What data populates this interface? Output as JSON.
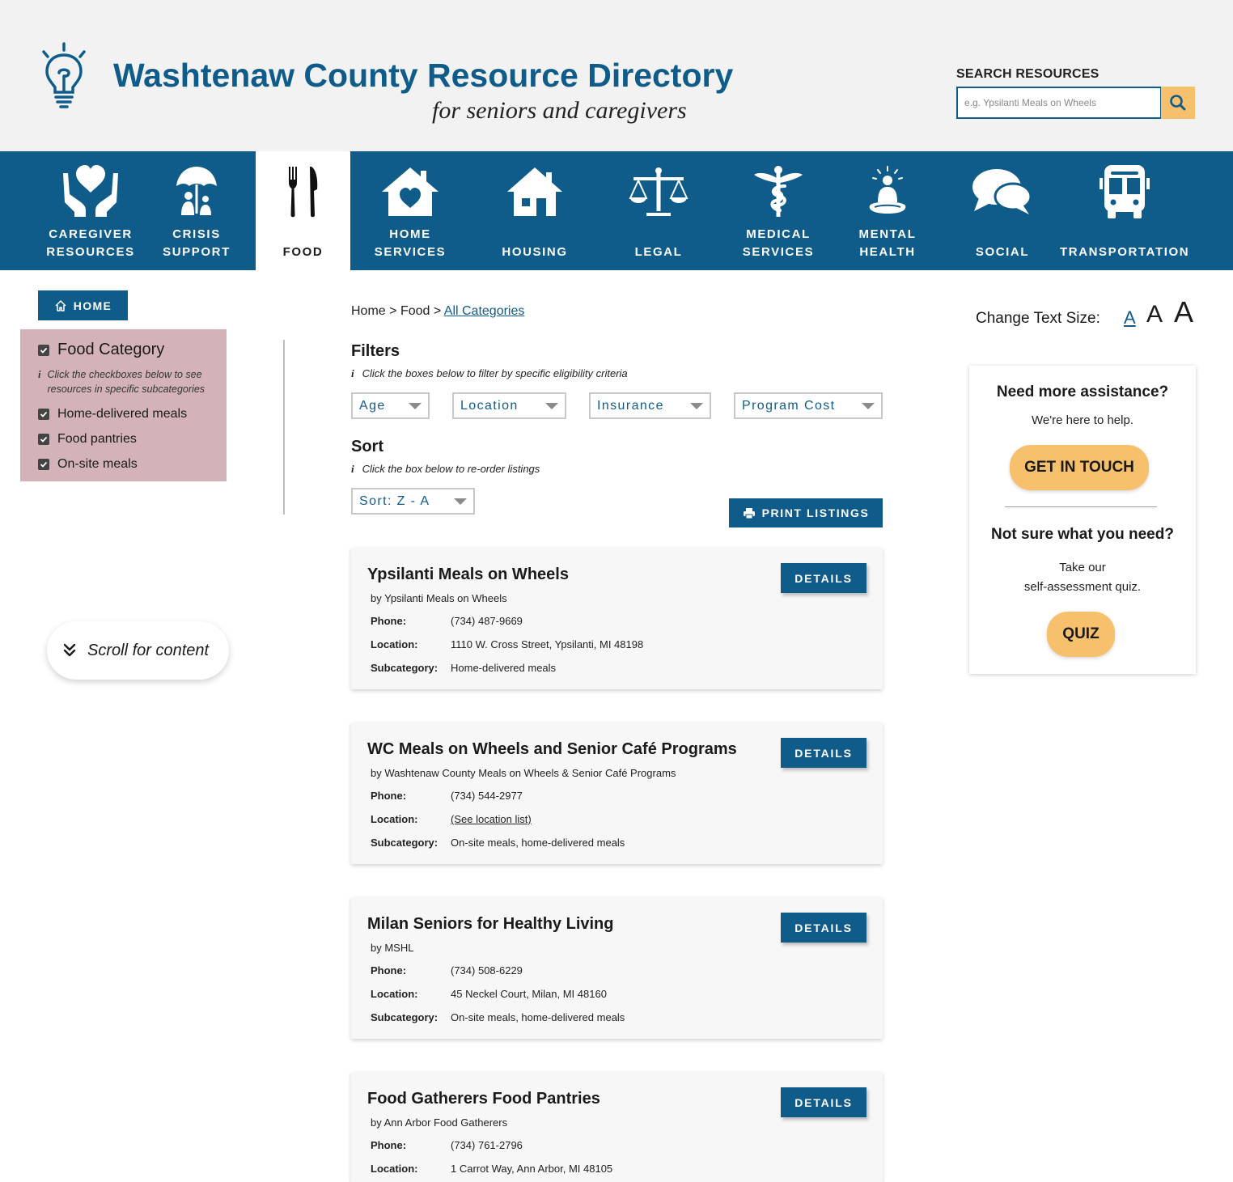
{
  "header": {
    "title": "Washtenaw County Resource Directory",
    "subtitle": "for seniors and caregivers",
    "search_label": "SEARCH RESOURCES",
    "search_placeholder": "e.g. Ypsilanti Meals on Wheels",
    "search_value": "",
    "logo_icon": "lightbulb-icon",
    "search_icon": "magnifier-icon"
  },
  "nav": [
    {
      "label": "CAREGIVER\nRESOURCES",
      "icon": "hands-heart-icon",
      "active": false
    },
    {
      "label": "CRISIS\nSUPPORT",
      "icon": "umbrella-people-icon",
      "active": false
    },
    {
      "label": "FOOD",
      "icon": "fork-knife-icon",
      "active": true
    },
    {
      "label": "HOME\nSERVICES",
      "icon": "house-heart-icon",
      "active": false
    },
    {
      "label": "HOUSING",
      "icon": "house-icon",
      "active": false
    },
    {
      "label": "LEGAL",
      "icon": "scales-icon",
      "active": false
    },
    {
      "label": "MEDICAL\nSERVICES",
      "icon": "caduceus-icon",
      "active": false
    },
    {
      "label": "MENTAL\nHEALTH",
      "icon": "meditation-icon",
      "active": false
    },
    {
      "label": "SOCIAL",
      "icon": "chat-bubbles-icon",
      "active": false
    },
    {
      "label": "TRANSPORTATION",
      "icon": "bus-icon",
      "active": false
    }
  ],
  "sidebar": {
    "home_label": "HOME",
    "category_title": "Food Category",
    "category_hint": "Click the checkboxes below to see resources in specific subcategories",
    "hint_marker": "i",
    "options": [
      {
        "label": "Home-delivered meals",
        "checked": true
      },
      {
        "label": "Food pantries",
        "checked": true
      },
      {
        "label": "On-site meals",
        "checked": true
      }
    ],
    "scroll_label": "Scroll for content"
  },
  "main": {
    "breadcrumb": {
      "home": "Home",
      "sep": ">",
      "food": "Food",
      "current": "All Categories"
    },
    "filters_title": "Filters",
    "filters_hint": "Click the boxes below to filter by specific eligibility criteria",
    "filters": [
      "Age",
      "Location",
      "Insurance",
      "Program Cost"
    ],
    "sort_title": "Sort",
    "sort_hint": "Click the box below to re-order listings",
    "sort_value": "Sort: Z - A",
    "print_label": "PRINT LISTINGS",
    "details_label": "DETAILS",
    "field_labels": {
      "phone": "Phone:",
      "location": "Location:",
      "subcategory": "Subcategory:"
    },
    "listings": [
      {
        "title": "Ypsilanti Meals on Wheels",
        "by": "by Ypsilanti Meals on Wheels",
        "phone": "(734) 487-9669",
        "location": "1110 W. Cross Street, Ypsilanti, MI 48198",
        "subcategory": "Home-delivered meals"
      },
      {
        "title": "WC Meals on Wheels and Senior Café Programs",
        "by": "by Washtenaw County Meals on Wheels & Senior Café Programs",
        "phone": "(734) 544-2977",
        "location": "(See location list)",
        "subcategory": "On-site meals, home-delivered meals"
      },
      {
        "title": "Milan Seniors for Healthy Living",
        "by": "by MSHL",
        "phone": "(734) 508-6229",
        "location": "45 Neckel Court, Milan, MI 48160",
        "subcategory": "On-site meals, home-delivered meals"
      },
      {
        "title": "Food Gatherers Food Pantries",
        "by": "by Ann Arbor Food Gatherers",
        "phone": "(734) 761-2796",
        "location": "1 Carrot Way, Ann Arbor, MI 48105",
        "subcategory": ""
      }
    ]
  },
  "right": {
    "text_size_label": "Change Text Size:",
    "text_size_options": [
      "A",
      "A",
      "A"
    ],
    "assist_title": "Need more assistance?",
    "assist_text": "We're here to help.",
    "contact_label": "GET IN TOUCH",
    "unsure_title": "Not sure what you need?",
    "unsure_text": "Take our\nself-assessment quiz.",
    "quiz_label": "QUIZ"
  },
  "colors": {
    "brand_blue": "#0f5c8a",
    "accent_yellow": "#f7c06c",
    "category_panel": "#d3b3b7",
    "header_bg": "#f2f2f2"
  }
}
